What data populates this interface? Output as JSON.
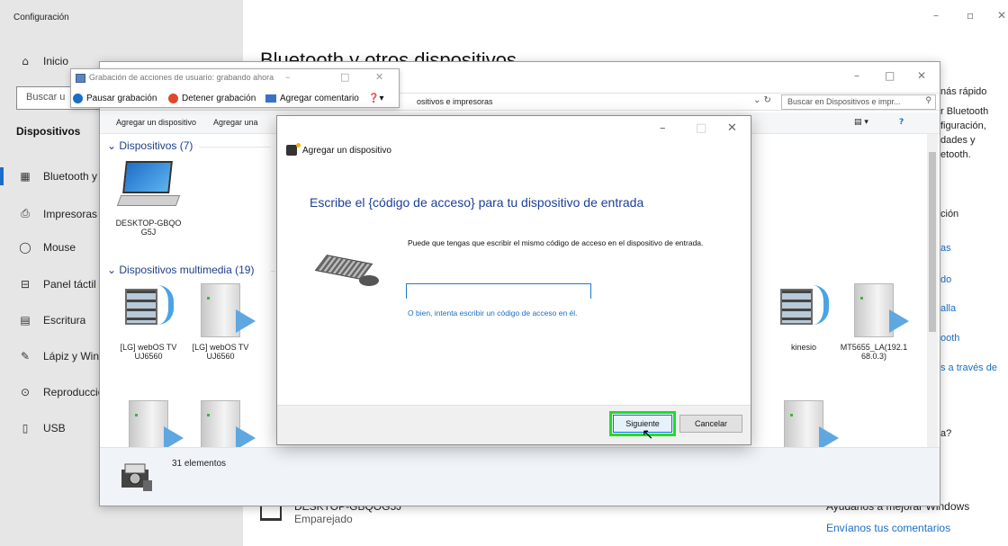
{
  "settings": {
    "window_title": "Configuración",
    "search_placeholder": "Buscar una configuración",
    "search_visible": "Buscar u",
    "nav_header": "Dispositivos",
    "nav_items": [
      {
        "label": "Inicio",
        "icon": "home-icon"
      },
      {
        "label": "Bluetooth y otros dispositivos",
        "visible": "Bluetooth y c",
        "icon": "bluetooth-devices-icon"
      },
      {
        "label": "Impresoras y escáneres",
        "visible": "Impresoras y",
        "icon": "printer-icon"
      },
      {
        "label": "Mouse",
        "icon": "mouse-icon"
      },
      {
        "label": "Panel táctil",
        "icon": "touchpad-icon"
      },
      {
        "label": "Escritura",
        "icon": "keyboard-icon"
      },
      {
        "label": "Lápiz y Windows Ink",
        "visible": "Lápiz y Wind",
        "icon": "pen-icon"
      },
      {
        "label": "Reproducción automática",
        "visible": "Reproducció",
        "icon": "autoplay-icon"
      },
      {
        "label": "USB",
        "icon": "usb-icon"
      }
    ],
    "page_title": "Bluetooth y otros dispositivos",
    "right_column": [
      "nás rápido",
      "r Bluetooth",
      "figuración,",
      "dades y",
      "etooth.",
      "ción",
      "as",
      "do",
      "alla",
      "ooth",
      "s a través de",
      "a?"
    ],
    "bottom_device": {
      "name": "DESKTOP-GBQOG5J",
      "status": "Emparejado"
    },
    "help_text": "Ayúdanos a mejorar Windows",
    "feedback_link": "Envíanos tus comentarios"
  },
  "explorer": {
    "address_text": "ositivos e impresoras",
    "search_placeholder": "Buscar en Dispositivos e impr...",
    "commands": [
      "Agregar un dispositivo",
      "Agregar una"
    ],
    "groups": [
      {
        "title": "Dispositivos (7)"
      },
      {
        "title": "Dispositivos multimedia (19)"
      }
    ],
    "devices": [
      {
        "name": "DESKTOP-GBQO G5J",
        "type": "laptop"
      },
      {
        "name": "[LG] webOS TV UJ6560",
        "type": "media"
      },
      {
        "name": "[LG] webOS TV UJ6560",
        "type": "server"
      },
      {
        "name": "kinesio",
        "type": "media"
      },
      {
        "name": "MT5655_LA(192.1 68.0.3)",
        "type": "server"
      }
    ],
    "status": "31 elementos"
  },
  "recorder": {
    "title": "Grabación de acciones de usuario: grabando ahora",
    "pause_label": "Pausar grabación",
    "stop_label": "Detener grabación",
    "comment_label": "Agregar comentario",
    "pause_color": "#1a6ec7",
    "stop_color": "#e0482b"
  },
  "dialog": {
    "header": "Agregar un dispositivo",
    "heading": "Escribe el {código de acceso} para tu dispositivo de entrada",
    "description": "Puede que tengas que escribir el mismo código de acceso en el dispositivo de entrada.",
    "input_value": "",
    "alt_link": "O bien, intenta escribir un código de acceso en él.",
    "next_label": "Siguiente",
    "cancel_label": "Cancelar",
    "highlight_color": "#22dd22"
  }
}
